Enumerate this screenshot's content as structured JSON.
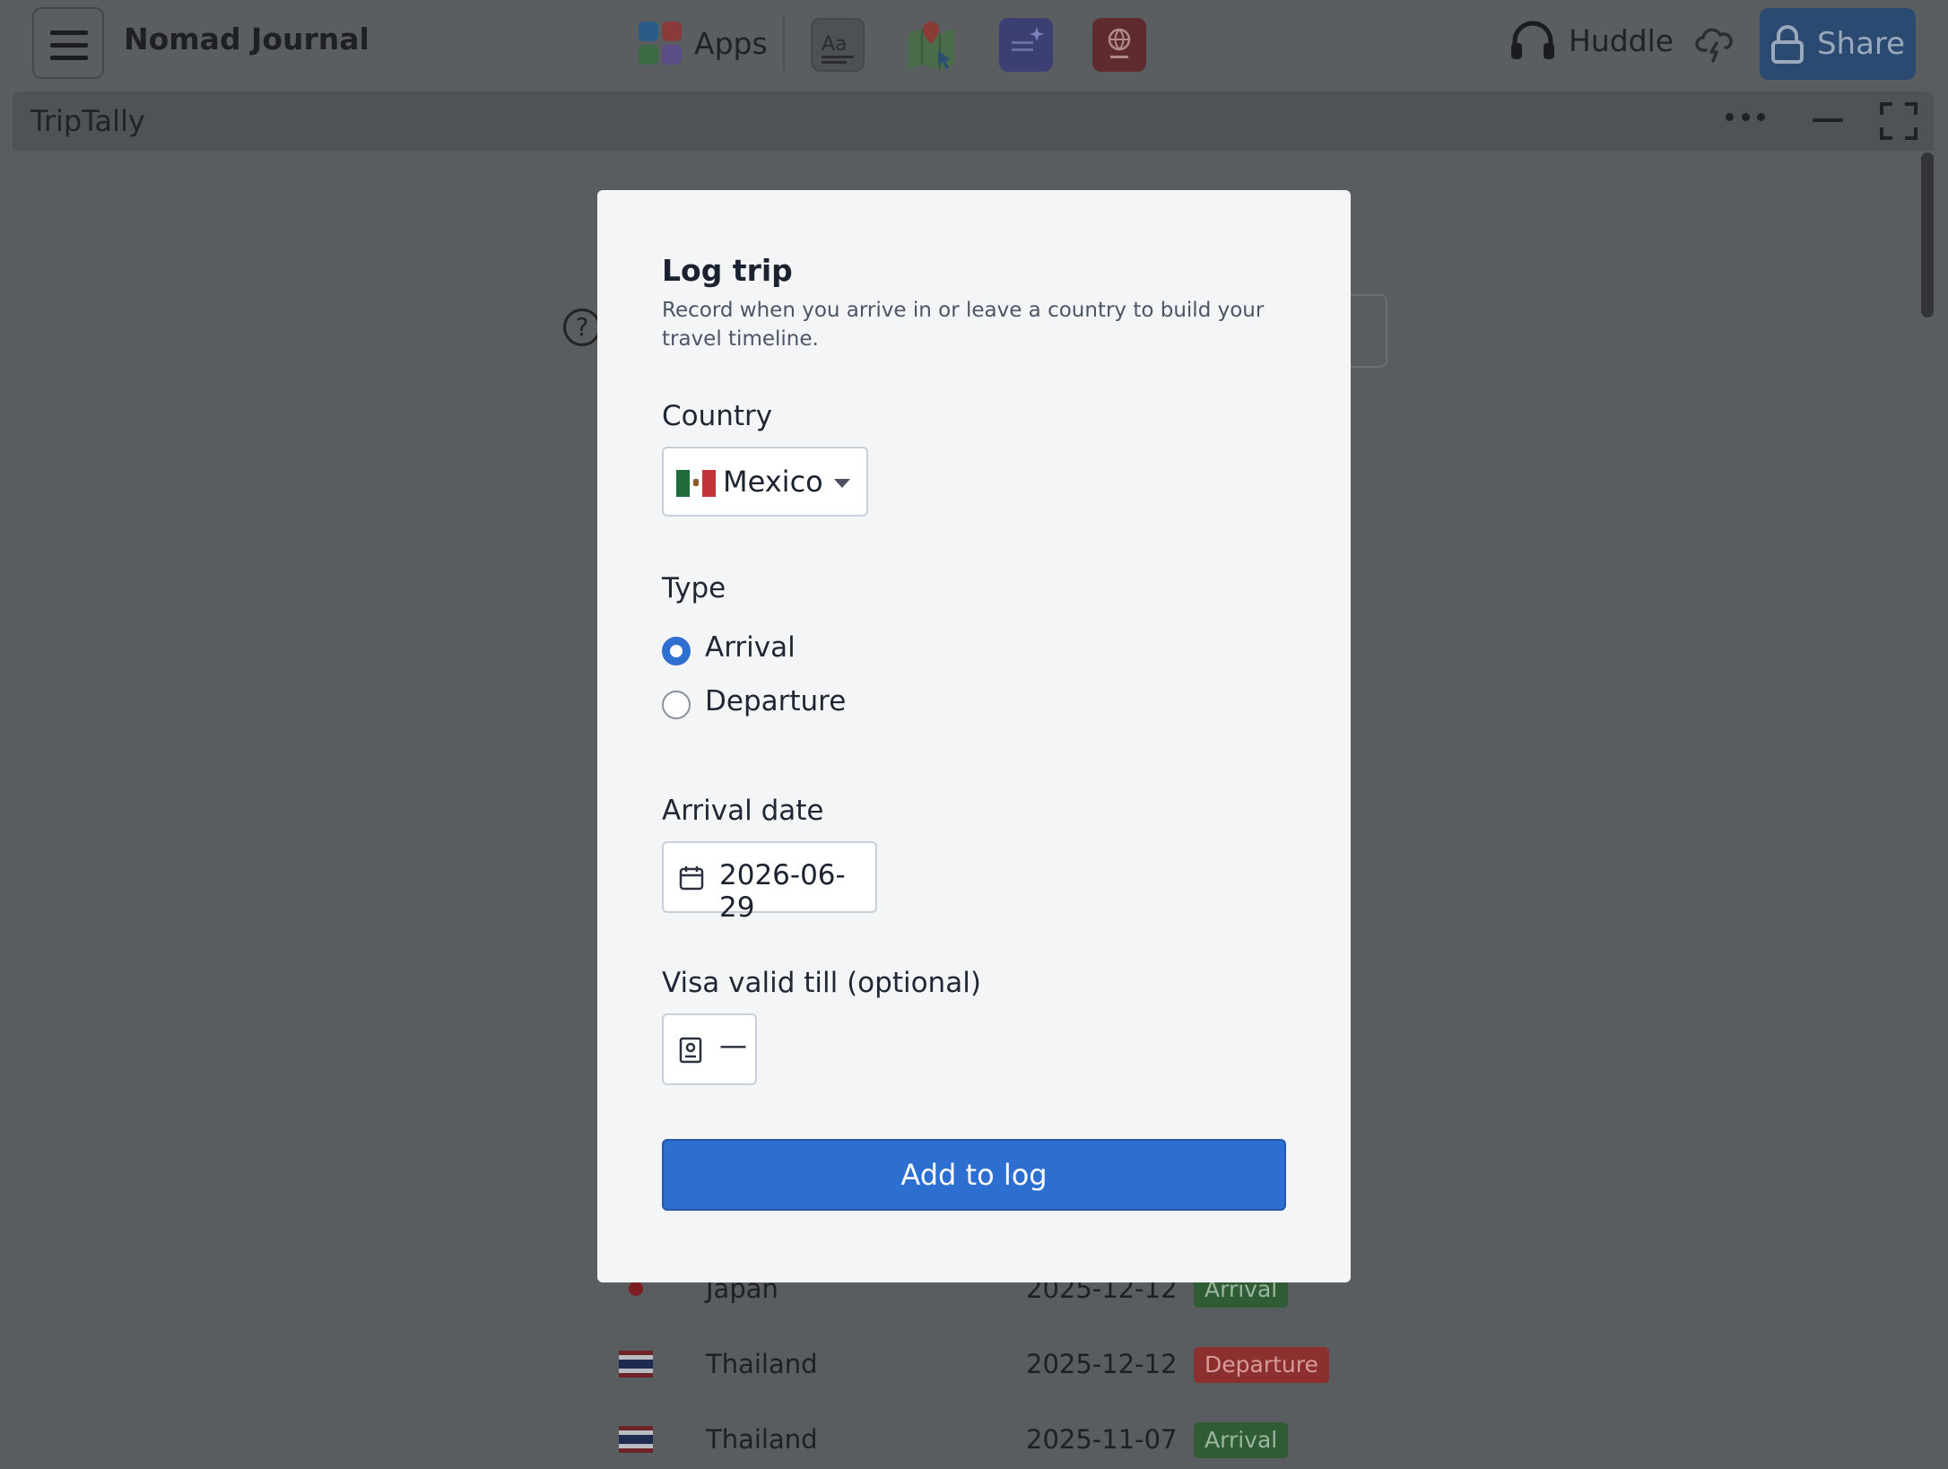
{
  "app": {
    "name": "Nomad Journal",
    "apps_label": "Apps",
    "huddle_label": "Huddle",
    "share_label": "Share"
  },
  "toolbar_icons": [
    "dictionary-icon",
    "map-icon",
    "notes-icon",
    "passport-icon"
  ],
  "window": {
    "title": "TripTally"
  },
  "modal": {
    "title": "Log trip",
    "description": "Record when you arrive in or leave a country to build your travel timeline.",
    "country_label": "Country",
    "country_value": "Mexico",
    "type_label": "Type",
    "type_options": [
      "Arrival",
      "Departure"
    ],
    "type_selected": "Arrival",
    "date_label": "Arrival date",
    "date_value": "2026-06-29",
    "visa_label": "Visa valid till (optional)",
    "visa_value": "—",
    "submit_label": "Add to log"
  },
  "log_rows": [
    {
      "country": "Japan",
      "date": "2025-12-12",
      "type": "Arrival"
    },
    {
      "country": "Thailand",
      "date": "2025-12-12",
      "type": "Departure"
    },
    {
      "country": "Thailand",
      "date": "2025-11-07",
      "type": "Arrival"
    }
  ],
  "colors": {
    "accent": "#2d6ed1",
    "arrival_badge": "#2f5c34",
    "departure_badge": "#8b2f2f"
  }
}
